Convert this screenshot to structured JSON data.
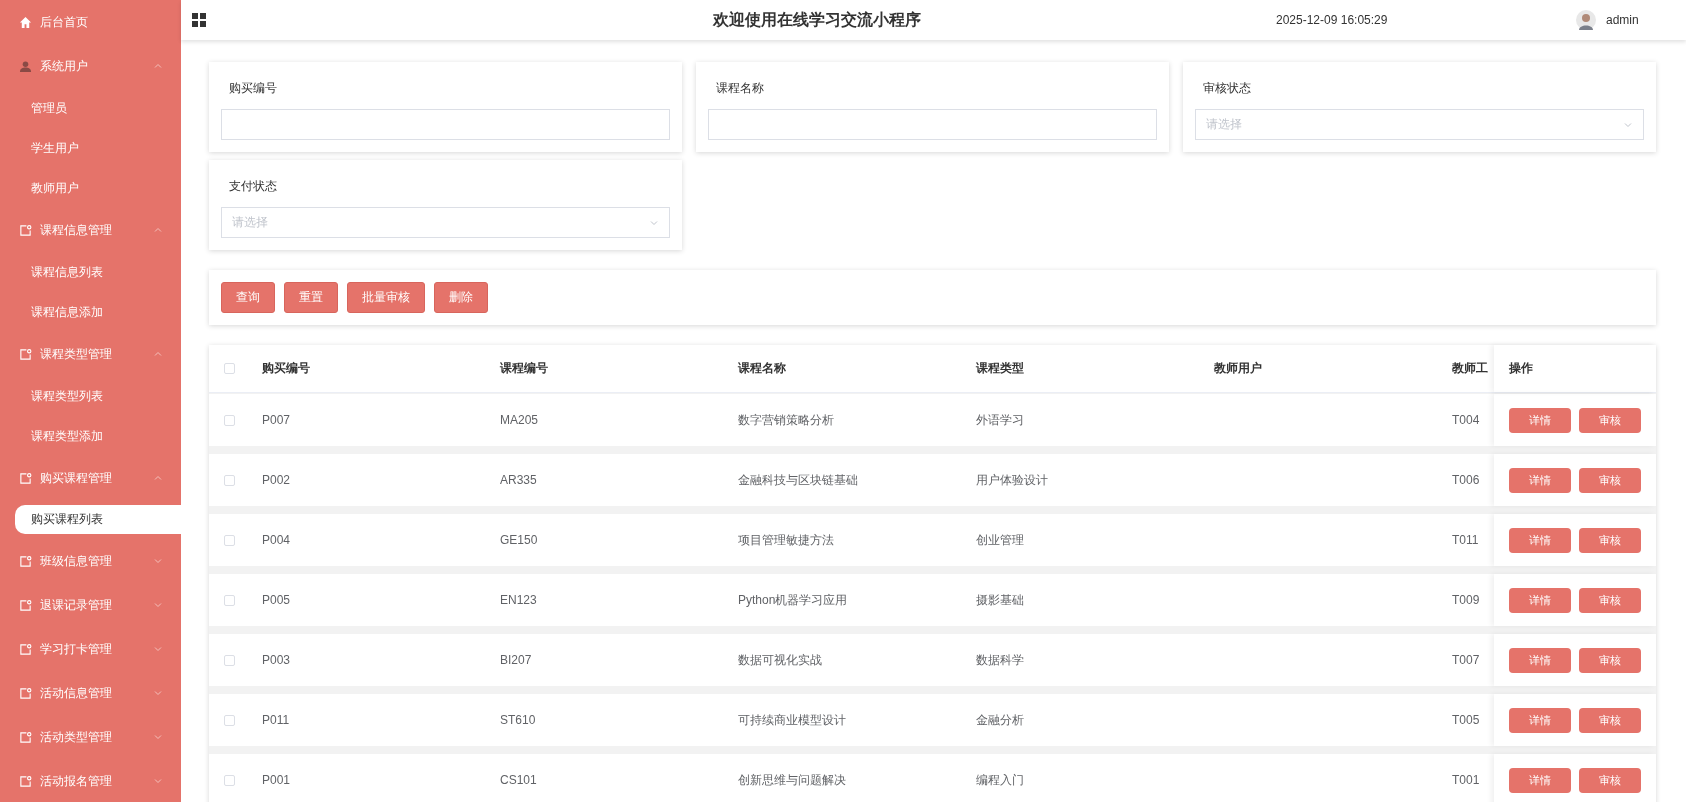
{
  "sidebar": {
    "items": [
      {
        "label": "后台首页",
        "kind": "home"
      },
      {
        "label": "系统用户",
        "kind": "user",
        "expanded": true,
        "children": [
          {
            "label": "管理员",
            "selected": false
          },
          {
            "label": "学生用户",
            "selected": false
          },
          {
            "label": "教师用户",
            "selected": false
          }
        ]
      },
      {
        "label": "课程信息管理",
        "kind": "doc",
        "expanded": true,
        "children": [
          {
            "label": "课程信息列表",
            "selected": false
          },
          {
            "label": "课程信息添加",
            "selected": false
          }
        ]
      },
      {
        "label": "课程类型管理",
        "kind": "doc",
        "expanded": true,
        "children": [
          {
            "label": "课程类型列表",
            "selected": false
          },
          {
            "label": "课程类型添加",
            "selected": false
          }
        ]
      },
      {
        "label": "购买课程管理",
        "kind": "doc",
        "expanded": true,
        "children": [
          {
            "label": "购买课程列表",
            "selected": true
          }
        ]
      },
      {
        "label": "班级信息管理",
        "kind": "doc",
        "expanded": false
      },
      {
        "label": "退课记录管理",
        "kind": "doc",
        "expanded": false
      },
      {
        "label": "学习打卡管理",
        "kind": "doc",
        "expanded": false
      },
      {
        "label": "活动信息管理",
        "kind": "doc",
        "expanded": false
      },
      {
        "label": "活动类型管理",
        "kind": "doc",
        "expanded": false
      },
      {
        "label": "活动报名管理",
        "kind": "doc",
        "expanded": false
      }
    ]
  },
  "header": {
    "title": "欢迎使用在线学习交流小程序",
    "datetime": "2025-12-09 16:05:29",
    "user": "admin"
  },
  "filters": [
    {
      "label": "购买编号",
      "kind": "text"
    },
    {
      "label": "课程名称",
      "kind": "text"
    },
    {
      "label": "审核状态",
      "kind": "select",
      "placeholder": "请选择"
    },
    {
      "label": "支付状态",
      "kind": "select",
      "placeholder": "请选择"
    }
  ],
  "buttons": [
    "查询",
    "重置",
    "批量审核",
    "删除"
  ],
  "table": {
    "select_all": {
      "checked": false
    },
    "columns": [
      "购买编号",
      "课程编号",
      "课程名称",
      "课程类型",
      "教师用户",
      "教师工"
    ],
    "actions_column": "操作",
    "rows": [
      {
        "checked": false,
        "cells": [
          "P007",
          "MA205",
          "数字营销策略分析",
          "外语学习",
          "",
          "T004"
        ],
        "actions": [
          "详情",
          "审核"
        ]
      },
      {
        "checked": false,
        "cells": [
          "P002",
          "AR335",
          "金融科技与区块链基础",
          "用户体验设计",
          "",
          "T006"
        ],
        "actions": [
          "详情",
          "审核"
        ]
      },
      {
        "checked": false,
        "cells": [
          "P004",
          "GE150",
          "项目管理敏捷方法",
          "创业管理",
          "",
          "T011"
        ],
        "actions": [
          "详情",
          "审核"
        ]
      },
      {
        "checked": false,
        "cells": [
          "P005",
          "EN123",
          "Python机器学习应用",
          "摄影基础",
          "",
          "T009"
        ],
        "actions": [
          "详情",
          "审核"
        ]
      },
      {
        "checked": false,
        "cells": [
          "P003",
          "BI207",
          "数据可视化实战",
          "数据科学",
          "",
          "T007"
        ],
        "actions": [
          "详情",
          "审核"
        ]
      },
      {
        "checked": false,
        "cells": [
          "P011",
          "ST610",
          "可持续商业模型设计",
          "金融分析",
          "",
          "T005"
        ],
        "actions": [
          "详情",
          "审核"
        ]
      },
      {
        "checked": false,
        "cells": [
          "P001",
          "CS101",
          "创新思维与问题解决",
          "编程入门",
          "",
          "T001"
        ],
        "actions": [
          "详情",
          "审核"
        ]
      }
    ]
  }
}
